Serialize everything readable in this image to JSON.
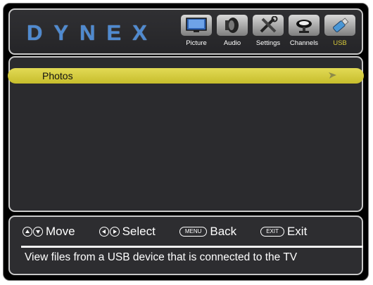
{
  "header": {
    "logo": "DYNEX",
    "tabs": [
      {
        "label": "Picture",
        "icon": "tv-icon",
        "active": false
      },
      {
        "label": "Audio",
        "icon": "speaker-icon",
        "active": false
      },
      {
        "label": "Settings",
        "icon": "tools-icon",
        "active": false
      },
      {
        "label": "Channels",
        "icon": "satellite-dish-icon",
        "active": false
      },
      {
        "label": "USB",
        "icon": "usb-drive-icon",
        "active": true
      }
    ]
  },
  "menu": {
    "items": [
      {
        "label": "Photos",
        "selected": true
      }
    ]
  },
  "footer": {
    "hints": {
      "move": "Move",
      "select": "Select",
      "menu_key": "MENU",
      "back": "Back",
      "exit_key": "EXIT",
      "exit": "Exit"
    },
    "description": "View files from a USB device that is connected to the TV"
  },
  "colors": {
    "highlight": "#d7cd40",
    "active_tab": "#d7c93a",
    "logo": "#4f8ad0",
    "background": "#000000"
  }
}
